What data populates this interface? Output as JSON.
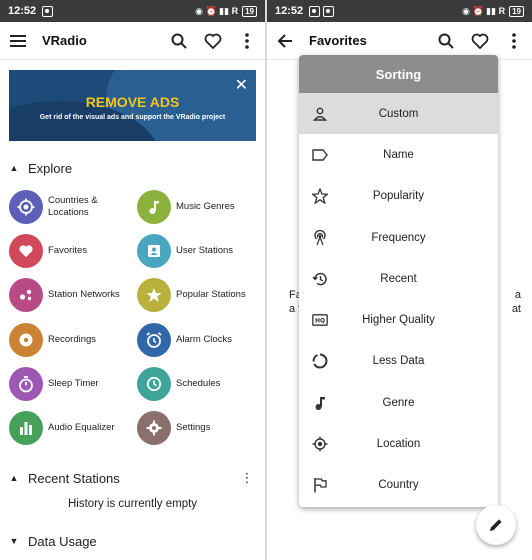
{
  "status_left": {
    "time": "12:52",
    "battery": "19"
  },
  "status_right": {
    "time": "12:52",
    "battery": "19"
  },
  "left": {
    "app_title": "VRadio",
    "banner": {
      "headline": "REMOVE ADS",
      "subtext": "Get rid of the visual ads and support the VRadio project"
    },
    "explore_title": "Explore",
    "explore_items": [
      {
        "label": "Countries & Locations",
        "color": "#5b5fb8",
        "icon": "location-target-icon"
      },
      {
        "label": "Music Genres",
        "color": "#8cb23e",
        "icon": "music-note-icon"
      },
      {
        "label": "Favorites",
        "color": "#d0485a",
        "icon": "heart-icon"
      },
      {
        "label": "User Stations",
        "color": "#4aa6bf",
        "icon": "user-badge-icon"
      },
      {
        "label": "Station Networks",
        "color": "#b84a86",
        "icon": "network-dots-icon"
      },
      {
        "label": "Popular Stations",
        "color": "#b8b23c",
        "icon": "star-icon"
      },
      {
        "label": "Recordings",
        "color": "#c98332",
        "icon": "record-icon"
      },
      {
        "label": "Alarm Clocks",
        "color": "#2f67a8",
        "icon": "alarm-clock-icon"
      },
      {
        "label": "Sleep Timer",
        "color": "#9c58b2",
        "icon": "stopwatch-icon"
      },
      {
        "label": "Schedules",
        "color": "#3fa59a",
        "icon": "clock-icon"
      },
      {
        "label": "Audio Equalizer",
        "color": "#47a059",
        "icon": "equalizer-icon"
      },
      {
        "label": "Settings",
        "color": "#8a6f6a",
        "icon": "gear-icon"
      }
    ],
    "recent_title": "Recent Stations",
    "recent_empty": "History is currently empty",
    "data_usage_title": "Data Usage"
  },
  "right": {
    "screen_title": "Favorites",
    "bg_text_left": [
      "Fa",
      "a fa"
    ],
    "bg_text_right": [
      "a",
      "at"
    ],
    "dialog_title": "Sorting",
    "sort_options": [
      {
        "label": "Custom",
        "icon": "person-icon",
        "selected": true
      },
      {
        "label": "Name",
        "icon": "label-tag-icon",
        "selected": false
      },
      {
        "label": "Popularity",
        "icon": "star-outline-icon",
        "selected": false
      },
      {
        "label": "Frequency",
        "icon": "antenna-icon",
        "selected": false
      },
      {
        "label": "Recent",
        "icon": "history-icon",
        "selected": false
      },
      {
        "label": "Higher Quality",
        "icon": "hq-icon",
        "selected": false
      },
      {
        "label": "Less Data",
        "icon": "data-saver-icon",
        "selected": false
      },
      {
        "label": "Genre",
        "icon": "music-note-icon",
        "selected": false
      },
      {
        "label": "Location",
        "icon": "gps-icon",
        "selected": false
      },
      {
        "label": "Country",
        "icon": "flag-icon",
        "selected": false
      }
    ]
  }
}
